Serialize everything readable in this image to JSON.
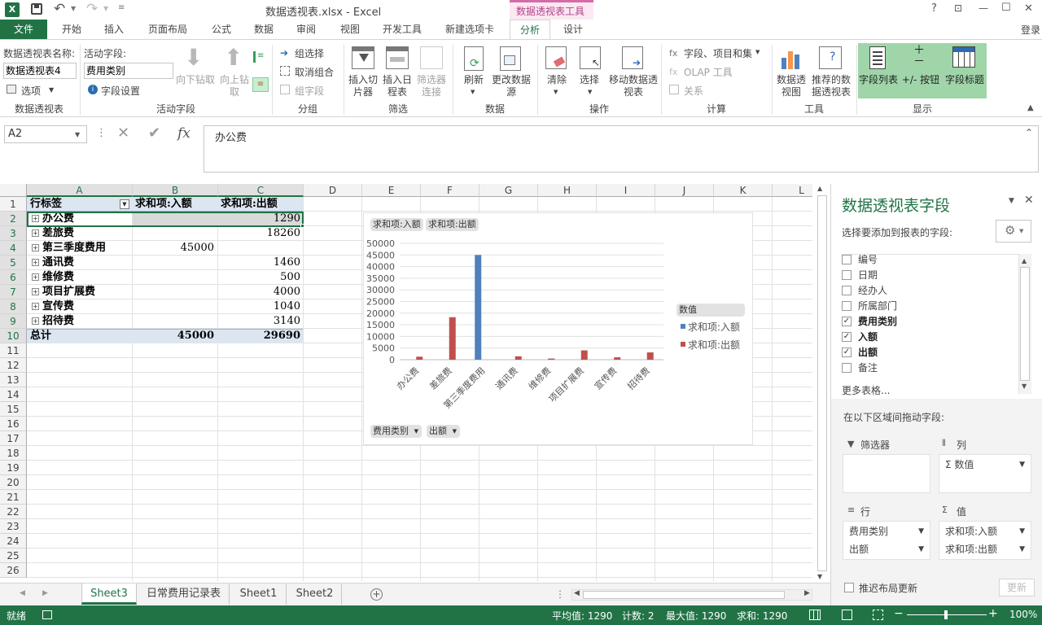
{
  "app": {
    "title": "数据透视表.xlsx - Excel",
    "context_tab_group": "数据透视表工具",
    "login": "登录",
    "help": "?",
    "win_min": "—",
    "win_max": "☐",
    "win_close": "✕",
    "win_restore": "⊡"
  },
  "tabs": [
    "文件",
    "开始",
    "插入",
    "页面布局",
    "公式",
    "数据",
    "审阅",
    "视图",
    "开发工具",
    "新建选项卡",
    "分析",
    "设计"
  ],
  "ribbon": {
    "pivot_name_label": "数据透视表名称:",
    "pivot_name_value": "数据透视表4",
    "options": "选项",
    "group_pivot": "数据透视表",
    "active_field_label": "活动字段:",
    "active_field_value": "费用类别",
    "field_settings": "字段设置",
    "drill_down": "向下钻取",
    "drill_up": "向上钻取",
    "group_active_field": "活动字段",
    "group_selection": "组选择",
    "ungroup": "取消组合",
    "group_field": "组字段",
    "group_group": "分组",
    "insert_slicer": "插入切片器",
    "insert_timeline": "插入日程表",
    "filter_connections": "筛选器连接",
    "group_filter": "筛选",
    "refresh": "刷新",
    "change_source": "更改数据源",
    "group_data": "数据",
    "clear": "清除",
    "select": "选择",
    "move_pivot": "移动数据透视表",
    "group_actions": "操作",
    "fields_items_sets": "字段、项目和集",
    "olap_tools": "OLAP 工具",
    "relationships": "关系",
    "group_calc": "计算",
    "pivot_chart": "数据透视图",
    "recommended": "推荐的数据透视表",
    "group_tools": "工具",
    "field_list": "字段列表",
    "plus_minus": "+/- 按钮",
    "field_headers": "字段标题",
    "group_show": "显示"
  },
  "formula": {
    "name_box": "A2",
    "content": "办公费",
    "fx": "fx"
  },
  "columns": [
    "A",
    "B",
    "C",
    "D",
    "E",
    "F",
    "G",
    "H",
    "I",
    "J",
    "K",
    "L"
  ],
  "rows": [
    "1",
    "2",
    "3",
    "4",
    "5",
    "6",
    "7",
    "8",
    "9",
    "10",
    "11",
    "12",
    "13",
    "14",
    "15",
    "16",
    "17",
    "18",
    "19",
    "20",
    "21",
    "22",
    "23",
    "24",
    "25",
    "26"
  ],
  "pivot": {
    "header": [
      "行标签",
      "求和项:入额",
      "求和项:出额"
    ],
    "rows": [
      {
        "label": "办公费",
        "in": "",
        "out": "1290"
      },
      {
        "label": "差旅费",
        "in": "",
        "out": "18260"
      },
      {
        "label": "第三季度费用",
        "in": "45000",
        "out": ""
      },
      {
        "label": "通讯费",
        "in": "",
        "out": "1460"
      },
      {
        "label": "维修费",
        "in": "",
        "out": "500"
      },
      {
        "label": "项目扩展费",
        "in": "",
        "out": "4000"
      },
      {
        "label": "宣传费",
        "in": "",
        "out": "1040"
      },
      {
        "label": "招待费",
        "in": "",
        "out": "3140"
      }
    ],
    "total": {
      "label": "总计",
      "in": "45000",
      "out": "29690"
    }
  },
  "chart_buttons": {
    "value1": "求和项:入额",
    "value2": "求和项:出额",
    "axis1": "费用类别",
    "axis2": "出额",
    "legend_title": "数值"
  },
  "chart_data": {
    "type": "bar",
    "categories": [
      "办公费",
      "差旅费",
      "第三季度费用",
      "通讯费",
      "维修费",
      "项目扩展费",
      "宣传费",
      "招待费"
    ],
    "series": [
      {
        "name": "求和项:入额",
        "color": "#4f81bd",
        "values": [
          0,
          0,
          45000,
          0,
          0,
          0,
          0,
          0
        ]
      },
      {
        "name": "求和项:出额",
        "color": "#c0504d",
        "values": [
          1290,
          18260,
          0,
          1460,
          500,
          4000,
          1040,
          3140
        ]
      }
    ],
    "ylim": [
      0,
      50000
    ],
    "yticks": [
      "0",
      "5000",
      "10000",
      "15000",
      "20000",
      "25000",
      "30000",
      "35000",
      "40000",
      "45000",
      "50000"
    ],
    "grid": true,
    "legend": "right"
  },
  "sheets": [
    "Sheet3",
    "日常费用记录表",
    "Sheet1",
    "Sheet2"
  ],
  "status": {
    "ready": "就绪",
    "average": "平均值: 1290",
    "count": "计数: 2",
    "max": "最大值: 1290",
    "sum": "求和: 1290",
    "zoom": "100%"
  },
  "taskpane": {
    "title": "数据透视表字段",
    "choose_label": "选择要添加到报表的字段:",
    "fields": [
      {
        "name": "编号",
        "checked": false
      },
      {
        "name": "日期",
        "checked": false
      },
      {
        "name": "经办人",
        "checked": false
      },
      {
        "name": "所属部门",
        "checked": false
      },
      {
        "name": "费用类别",
        "checked": true
      },
      {
        "name": "入额",
        "checked": true
      },
      {
        "name": "出额",
        "checked": true
      },
      {
        "name": "备注",
        "checked": false
      }
    ],
    "more_tables": "更多表格...",
    "drag_label": "在以下区域间拖动字段:",
    "filters_label": "筛选器",
    "columns_label": "列",
    "rows_label": "行",
    "values_label": "值",
    "columns_items": [
      "Σ 数值"
    ],
    "rows_items": [
      "费用类别",
      "出额"
    ],
    "values_items": [
      "求和项:入额",
      "求和项:出额"
    ],
    "defer_update": "推迟布局更新",
    "update_button": "更新"
  }
}
